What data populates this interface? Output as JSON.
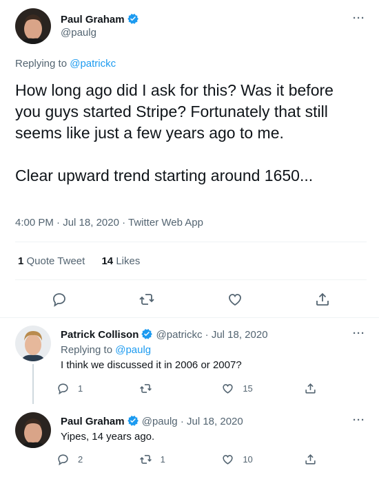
{
  "main_tweet": {
    "author_name": "Paul Graham",
    "author_handle": "@paulg",
    "replying_prefix": "Replying to ",
    "replying_to": "@patrickc",
    "text": "How long ago did I ask for this? Was it before you guys started Stripe? Fortunately that still seems like just a few years ago to me.\n\nClear upward trend starting around 1650...",
    "time": "4:00 PM",
    "date": "Jul 18, 2020",
    "source": "Twitter Web App",
    "sep": " · ",
    "quote_count": "1",
    "quote_label": "Quote Tweet",
    "like_count": "14",
    "like_label": "Likes",
    "more": "···"
  },
  "replies": [
    {
      "author_name": "Patrick Collison",
      "author_handle": "@patrickc",
      "date": "Jul 18, 2020",
      "sep": " · ",
      "replying_prefix": "Replying to ",
      "replying_to": "@paulg",
      "text": "I think we discussed it in 2006 or 2007?",
      "reply_count": "1",
      "retweet_count": "",
      "like_count": "15",
      "more": "···"
    },
    {
      "author_name": "Paul Graham",
      "author_handle": "@paulg",
      "date": "Jul 18, 2020",
      "sep": " · ",
      "text": "Yipes, 14 years ago.",
      "reply_count": "2",
      "retweet_count": "1",
      "like_count": "10",
      "more": "···"
    }
  ],
  "colors": {
    "accent": "#1d9bf0",
    "secondary_text": "#536471",
    "primary_text": "#0f1419",
    "divider": "#eff3f4"
  },
  "icons": [
    "verified-badge-icon",
    "reply-icon",
    "retweet-icon",
    "like-icon",
    "share-icon",
    "more-icon"
  ]
}
